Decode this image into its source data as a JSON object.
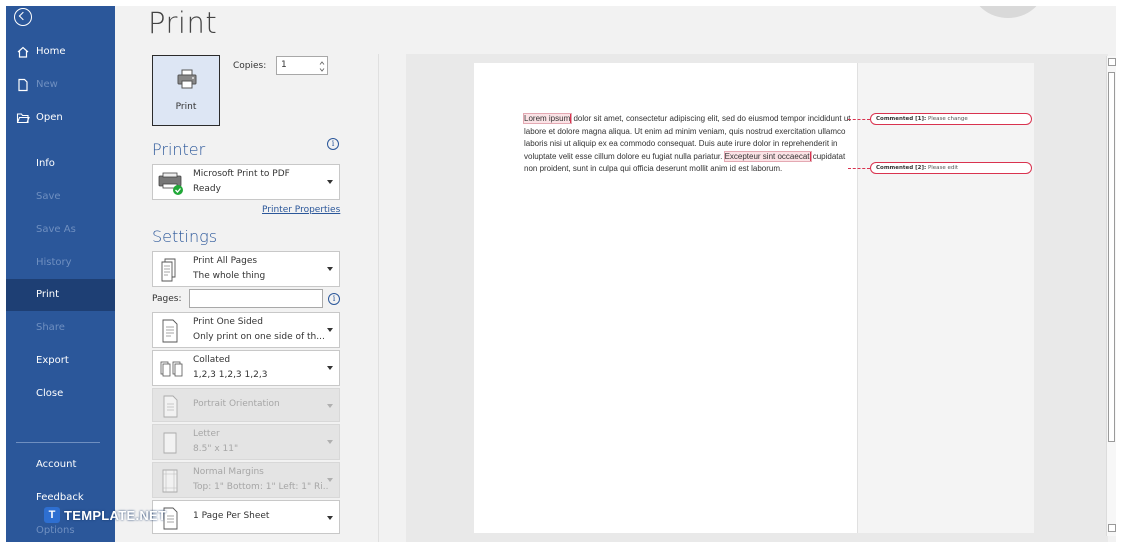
{
  "sidebar": {
    "items": [
      {
        "label": "Home",
        "icon": "home-icon",
        "state": "normal"
      },
      {
        "label": "New",
        "icon": "new-document-icon",
        "state": "dim"
      },
      {
        "label": "Open",
        "icon": "open-folder-icon",
        "state": "normal"
      },
      {
        "label": "Info",
        "state": "normal"
      },
      {
        "label": "Save",
        "state": "dim"
      },
      {
        "label": "Save As",
        "state": "dim"
      },
      {
        "label": "History",
        "state": "dim"
      },
      {
        "label": "Print",
        "state": "active"
      },
      {
        "label": "Share",
        "state": "dim"
      },
      {
        "label": "Export",
        "state": "normal"
      },
      {
        "label": "Close",
        "state": "normal"
      },
      {
        "label": "Account",
        "state": "normal"
      },
      {
        "label": "Feedback",
        "state": "normal"
      },
      {
        "label": "Options",
        "state": "dim"
      }
    ]
  },
  "page": {
    "title": "Print"
  },
  "print_button": {
    "label": "Print",
    "icon": "printer-icon"
  },
  "copies": {
    "label": "Copies:",
    "value": "1"
  },
  "printer": {
    "heading": "Printer",
    "name": "Microsoft Print to PDF",
    "status": "Ready",
    "properties_link": "Printer Properties"
  },
  "settings": {
    "heading": "Settings",
    "print_range": {
      "line1": "Print All Pages",
      "line2": "The whole thing"
    },
    "pages_label": "Pages:",
    "pages_value": "",
    "sides": {
      "line1": "Print One Sided",
      "line2": "Only print on one side of th..."
    },
    "collation": {
      "line1": "Collated",
      "line2": "1,2,3    1,2,3    1,2,3"
    },
    "orientation": {
      "line1": "Portrait Orientation",
      "line2": ""
    },
    "paper": {
      "line1": "Letter",
      "line2": "8.5\" x 11\""
    },
    "margins": {
      "line1": "Normal Margins",
      "line2": "Top: 1\" Bottom: 1\" Left: 1\" Ri..."
    },
    "per_sheet": {
      "line1": "1 Page Per Sheet",
      "line2": ""
    }
  },
  "preview": {
    "highlight1": "Lorem ipsum",
    "text1": " dolor sit amet, consectetur adipiscing elit, sed do eiusmod tempor incididunt ut labore et dolore magna aliqua. Ut enim ad minim veniam, quis nostrud exercitation ullamco laboris nisi ut aliquip ex ea commodo consequat. Duis aute irure dolor in reprehenderit in voluptate velit esse cillum dolore eu fugiat nulla pariatur. ",
    "highlight2": "Excepteur sint occaecat",
    "text2": " cupidatat non proident, sunt in culpa qui officia deserunt mollit anim id est laborum.",
    "comments": [
      {
        "author": "Commented [1]:",
        "text": "Please change"
      },
      {
        "author": "Commented [2]:",
        "text": "Please edit"
      }
    ]
  },
  "watermark": {
    "mark": "T",
    "text": "TEMPLATE",
    "suffix": ".NET"
  },
  "colors": {
    "sidebar": "#2b579a",
    "active": "#1e3f74",
    "accent": "#2b579a",
    "comment": "#d9334f"
  }
}
